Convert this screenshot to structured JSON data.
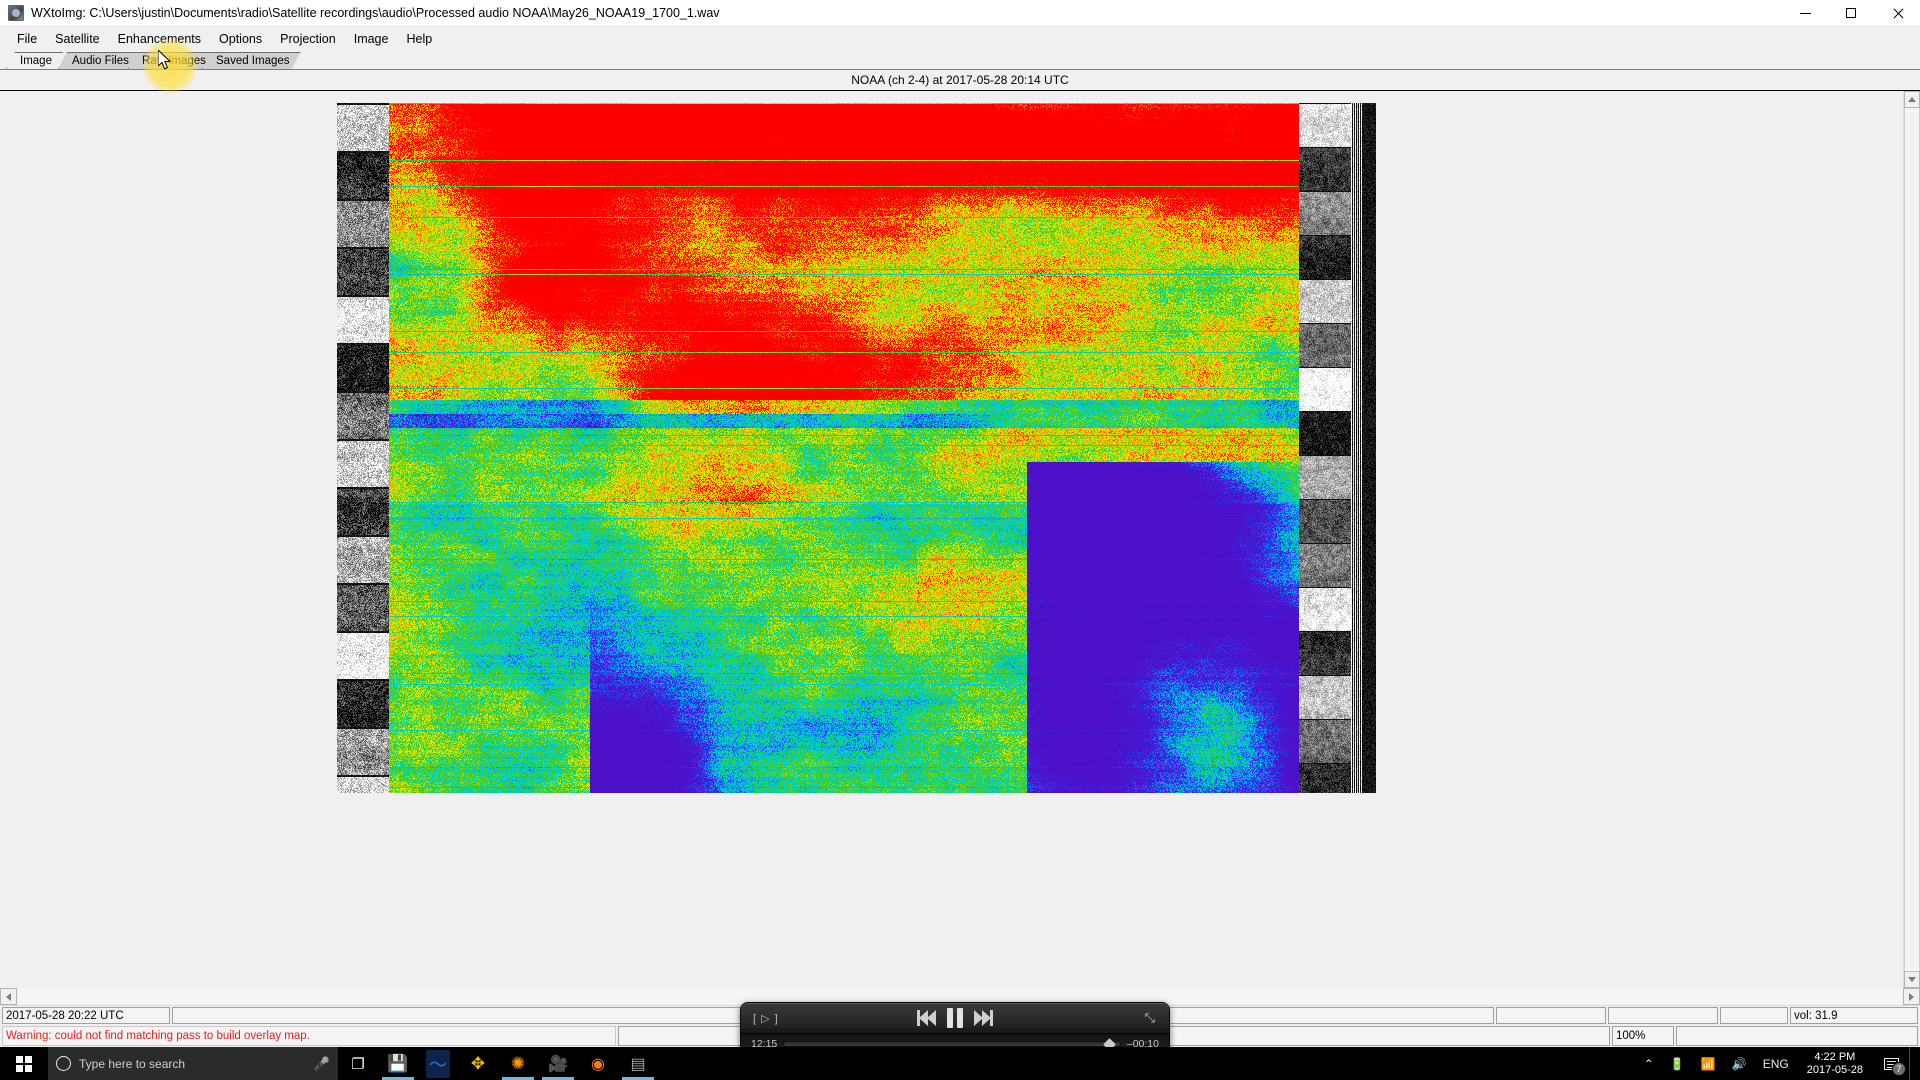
{
  "window": {
    "title": "WXtoImg: C:\\Users\\justin\\Documents\\radio\\Satellite recordings\\audio\\Processed audio NOAA\\May26_NOAA19_1700_1.wav",
    "app_icon": "satellite-app-icon",
    "controls": {
      "minimize": "minimize-icon",
      "maximize": "maximize-icon",
      "close": "close-icon"
    }
  },
  "menu": {
    "items": [
      {
        "label": "File"
      },
      {
        "label": "Satellite"
      },
      {
        "label": "Enhancements"
      },
      {
        "label": "Options"
      },
      {
        "label": "Projection"
      },
      {
        "label": "Image"
      },
      {
        "label": "Help"
      }
    ]
  },
  "tabs": [
    {
      "label": "Image",
      "selected": true
    },
    {
      "label": "Audio Files",
      "selected": false
    },
    {
      "label": "Raw Images",
      "selected": false
    },
    {
      "label": "Saved Images",
      "selected": false
    }
  ],
  "caption": "NOAA (ch 2-4) at 2017-05-28  20:14 UTC",
  "image_view": {
    "description": "NOAA APT false-colour satellite composite with greyscale telemetry wedges on left and right edges",
    "palette": [
      "#ff0000",
      "#ff8000",
      "#ffff00",
      "#80ff00",
      "#00c000",
      "#00e0e0",
      "#0080ff",
      "#4b10c8",
      "#ffffff",
      "#000000"
    ]
  },
  "status": {
    "timestamp": "2017-05-28  20:22 UTC",
    "volume": "vol: 31.9",
    "warning": "Warning: could not find matching pass to build overlay map.",
    "zoom": "100%"
  },
  "media_player": {
    "airplay_label": "[ ▷ ]",
    "elapsed": "12:15",
    "remaining": "–00:10",
    "prev_icon": "rewind-icon",
    "play_state_icon": "pause-icon",
    "next_icon": "fast-forward-icon",
    "expand_icon": "collapse-icon"
  },
  "taskbar": {
    "start_icon": "windows-start-icon",
    "search_placeholder": "Type here to search",
    "search_icon": "cortana-circle-icon",
    "mic_icon": "microphone-icon",
    "apps": [
      {
        "name": "task-view-icon",
        "glyph": "❐",
        "color": "#ffffff",
        "active": false
      },
      {
        "name": "save-floppy-icon",
        "glyph": "💾",
        "color": "#d8e4f2",
        "active": true
      },
      {
        "name": "audacity-icon",
        "glyph": "〜",
        "color": "#2e6fd4",
        "active": false
      },
      {
        "name": "puzzle-icon",
        "glyph": "✥",
        "color": "#f2c11a",
        "active": false
      },
      {
        "name": "sdr-sharp-icon",
        "glyph": "✺",
        "color": "#ff9a10",
        "active": true
      },
      {
        "name": "screen-recorder-icon",
        "glyph": "🎥",
        "color": "#9b3fa8",
        "active": true
      },
      {
        "name": "wxtoimg-flame-icon",
        "glyph": "◉",
        "color": "#ff7a18",
        "active": false
      },
      {
        "name": "wxtoimg-window-icon",
        "glyph": "▤",
        "color": "#9aa3ad",
        "active": true
      }
    ],
    "tray": {
      "chevron_icon": "chevron-up-icon",
      "battery_icon": "battery-charging-icon",
      "network_icon": "wifi-icon",
      "volume_icon": "speaker-icon",
      "language": "ENG",
      "time": "4:22 PM",
      "date": "2017-05-28",
      "notifications_icon": "notifications-icon",
      "notifications_count": "7"
    }
  },
  "pointer": {
    "highlight_color": "#ffdd33",
    "cursor_icon": "arrow-cursor",
    "target": "Raw Images tab"
  }
}
